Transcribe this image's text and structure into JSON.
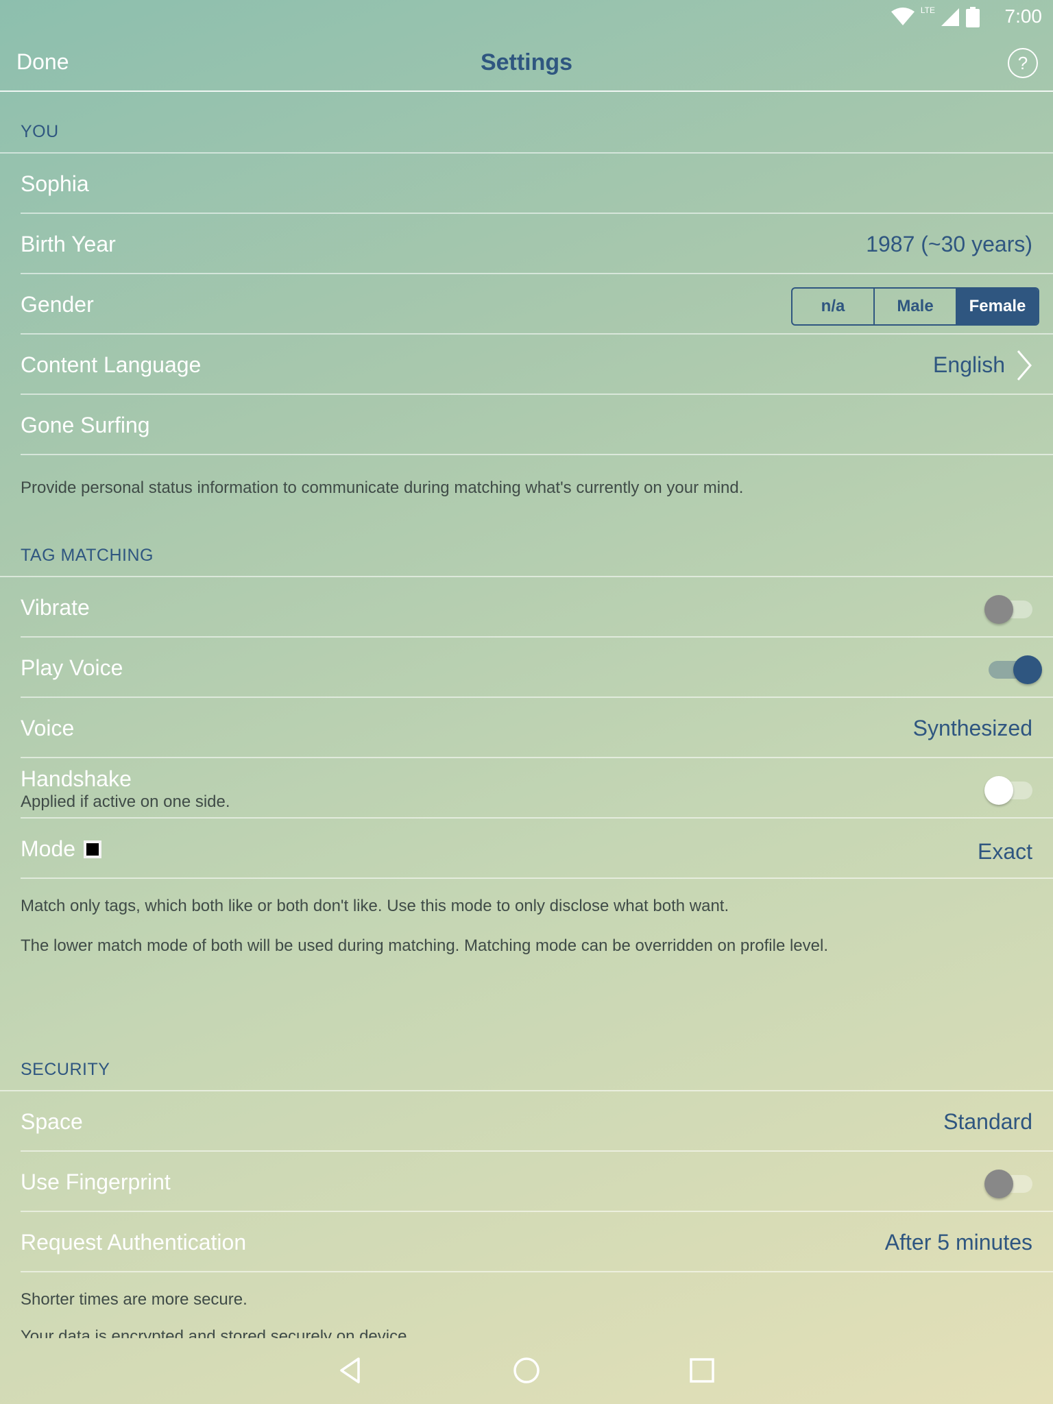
{
  "status_bar": {
    "time": "7:00",
    "network": "LTE",
    "icons": [
      "wifi-icon",
      "cellular-signal-icon",
      "battery-icon"
    ]
  },
  "appbar": {
    "done_label": "Done",
    "title": "Settings",
    "help_icon": "help-icon"
  },
  "you": {
    "header": "YOU",
    "name": "Sophia",
    "birth_year": {
      "label": "Birth Year",
      "value": "1987 (~30 years)"
    },
    "gender": {
      "label": "Gender",
      "options": [
        "n/a",
        "Male",
        "Female"
      ],
      "selected": "Female"
    },
    "content_language": {
      "label": "Content Language",
      "value": "English"
    },
    "status_text": "Gone Surfing",
    "note": "Provide personal status information to communicate during matching what's currently on your mind."
  },
  "tag_matching": {
    "header": "TAG MATCHING",
    "vibrate": {
      "label": "Vibrate",
      "on": false
    },
    "play_voice": {
      "label": "Play Voice",
      "on": true
    },
    "voice": {
      "label": "Voice",
      "value": "Synthesized"
    },
    "handshake": {
      "label": "Handshake",
      "sublabel": "Applied if active on one side.",
      "on": false
    },
    "mode": {
      "label": "Mode",
      "value": "Exact",
      "swatch_color": "#000000"
    },
    "note1": "Match only tags, which both like or both don't like. Use this mode to only disclose what both want.",
    "note2": "The lower match mode of both will be used during matching. Matching mode can be overridden on profile level."
  },
  "security": {
    "header": "SECURITY",
    "space": {
      "label": "Space",
      "value": "Standard"
    },
    "fingerprint": {
      "label": "Use Fingerprint",
      "on": false
    },
    "request_auth": {
      "label": "Request Authentication",
      "value": "After 5 minutes"
    },
    "note1": "Shorter times are more secure.",
    "note2": "Your data is encrypted and stored securely on device."
  },
  "navbar": {
    "icons": [
      "back-icon",
      "home-icon",
      "recents-icon"
    ]
  },
  "colors": {
    "accent": "#2f5680",
    "text_light": "#ffffff",
    "note_text": "#3f4b47"
  }
}
